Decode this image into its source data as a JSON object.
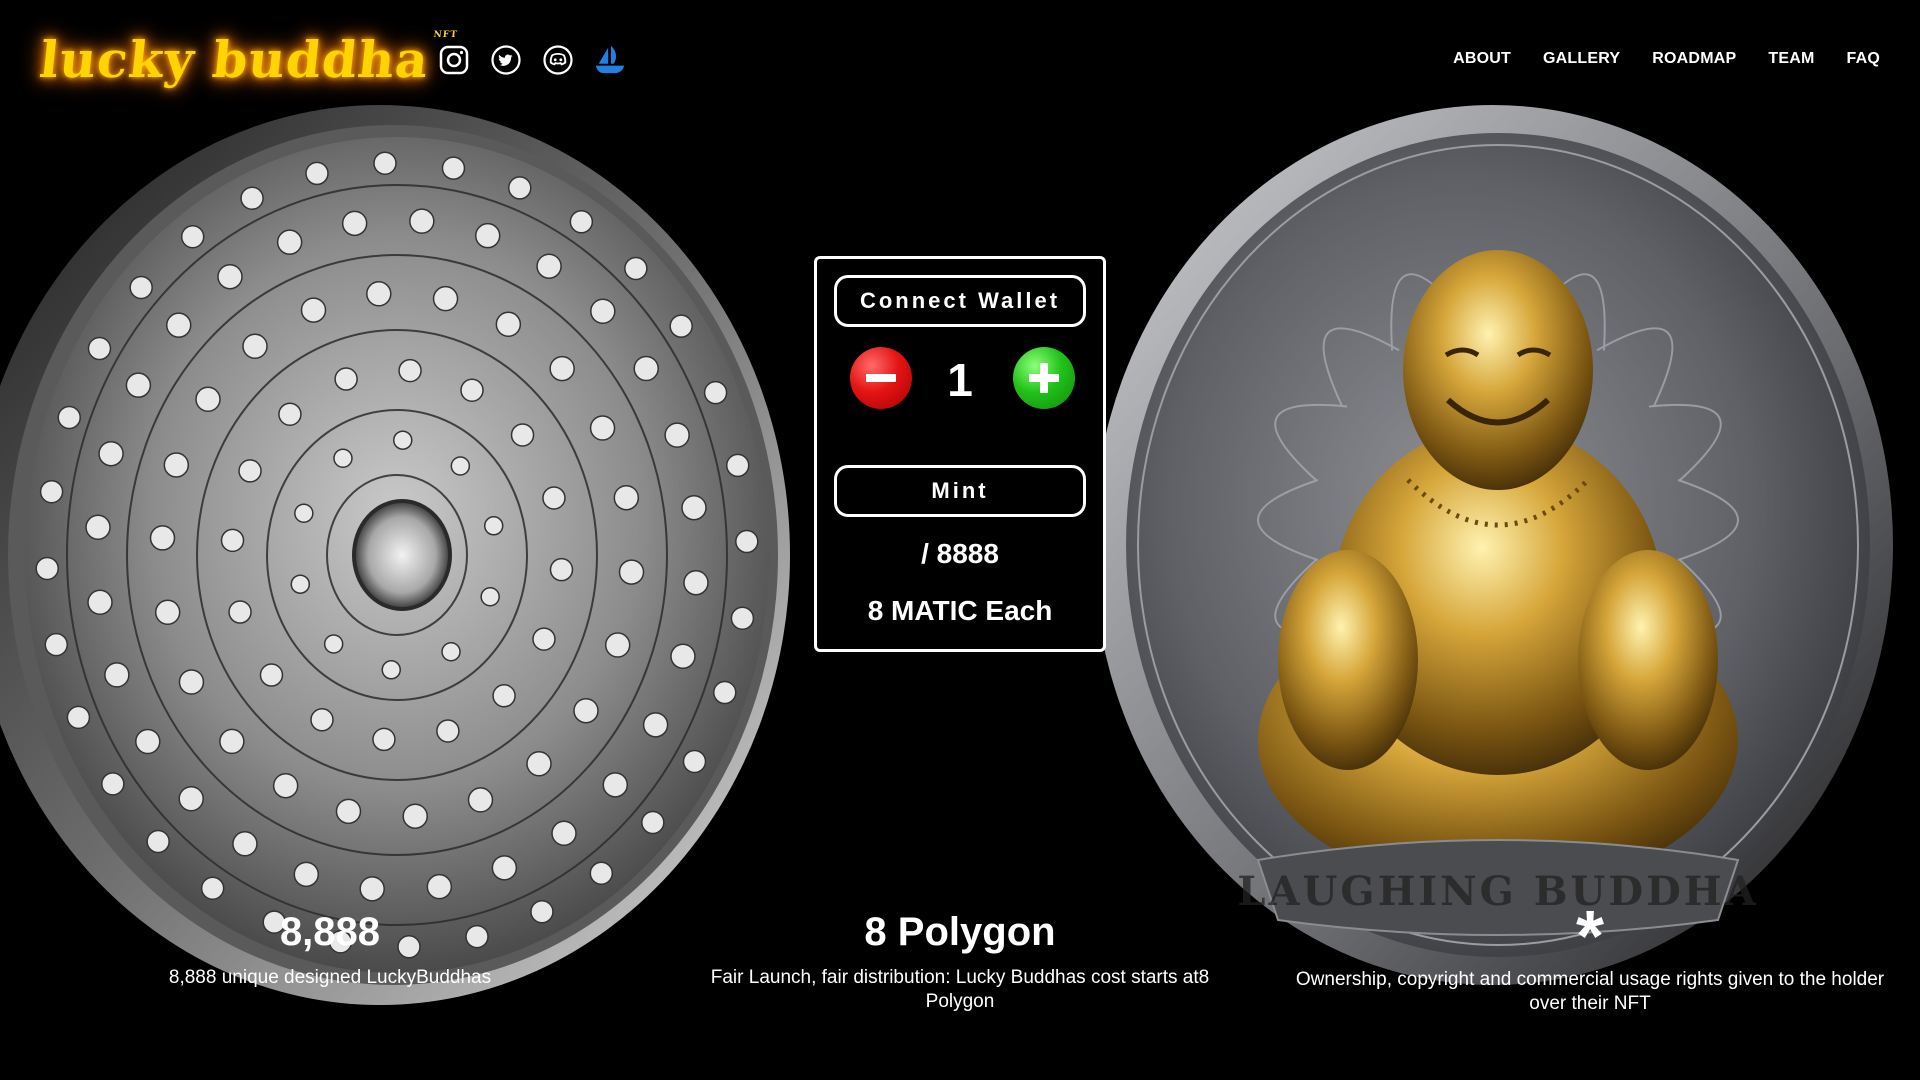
{
  "header": {
    "logo_text": "lucky buddha",
    "logo_mark": "NFT",
    "socials": [
      {
        "name": "instagram-icon",
        "label": "Instagram"
      },
      {
        "name": "twitter-icon",
        "label": "Twitter"
      },
      {
        "name": "discord-icon",
        "label": "Discord"
      },
      {
        "name": "opensea-icon",
        "label": "OpenSea"
      }
    ],
    "nav": [
      "ABOUT",
      "GALLERY",
      "ROADMAP",
      "TEAM",
      "FAQ"
    ]
  },
  "mint": {
    "connect_label": "Connect Wallet",
    "quantity": "1",
    "mint_label": "Mint",
    "supply": "/ 8888",
    "price": "8 MATIC Each"
  },
  "stats": [
    {
      "value": "8,888",
      "description": "8,888 unique designed LuckyBuddhas"
    },
    {
      "value": "8 Polygon",
      "description": "Fair Launch, fair distribution: Lucky Buddhas cost starts at8 Polygon"
    },
    {
      "value": "*",
      "description": "Ownership, copyright and commercial usage rights given to the holder over their NFT"
    }
  ],
  "coins": {
    "right_coin_inscription": "LAUGHING BUDDHA"
  },
  "colors": {
    "background": "#000000",
    "logo_glow": "#ffd400",
    "minus_button": "#e41414",
    "plus_button": "#22c21a",
    "opensea_blue": "#2081e2"
  }
}
